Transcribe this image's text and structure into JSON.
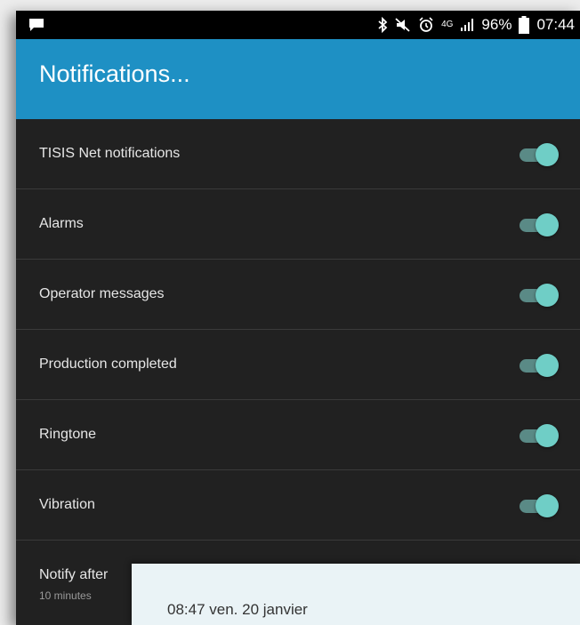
{
  "status_bar": {
    "icons": [
      "message-icon",
      "bluetooth-icon",
      "mute-icon",
      "alarm-icon",
      "network-4g-icon",
      "signal-icon",
      "battery-icon"
    ],
    "network_label": "4G",
    "battery": "96%",
    "time": "07:44"
  },
  "app_bar": {
    "title": "Notifications...",
    "color": "#1e90c4"
  },
  "settings": [
    {
      "label": "TISIS Net notifications",
      "enabled": true
    },
    {
      "label": "Alarms",
      "enabled": true
    },
    {
      "label": "Operator messages",
      "enabled": true
    },
    {
      "label": "Production completed",
      "enabled": true
    },
    {
      "label": "Ringtone",
      "enabled": true
    },
    {
      "label": "Vibration",
      "enabled": true
    }
  ],
  "notify_after": {
    "title": "Notify after",
    "value": "10 minutes"
  },
  "notification_card": {
    "datetime": "08:47  ven. 20 janvier"
  },
  "colors": {
    "toggle_thumb": "#6fcec6",
    "toggle_track": "#5a8a86",
    "background": "#212121"
  }
}
